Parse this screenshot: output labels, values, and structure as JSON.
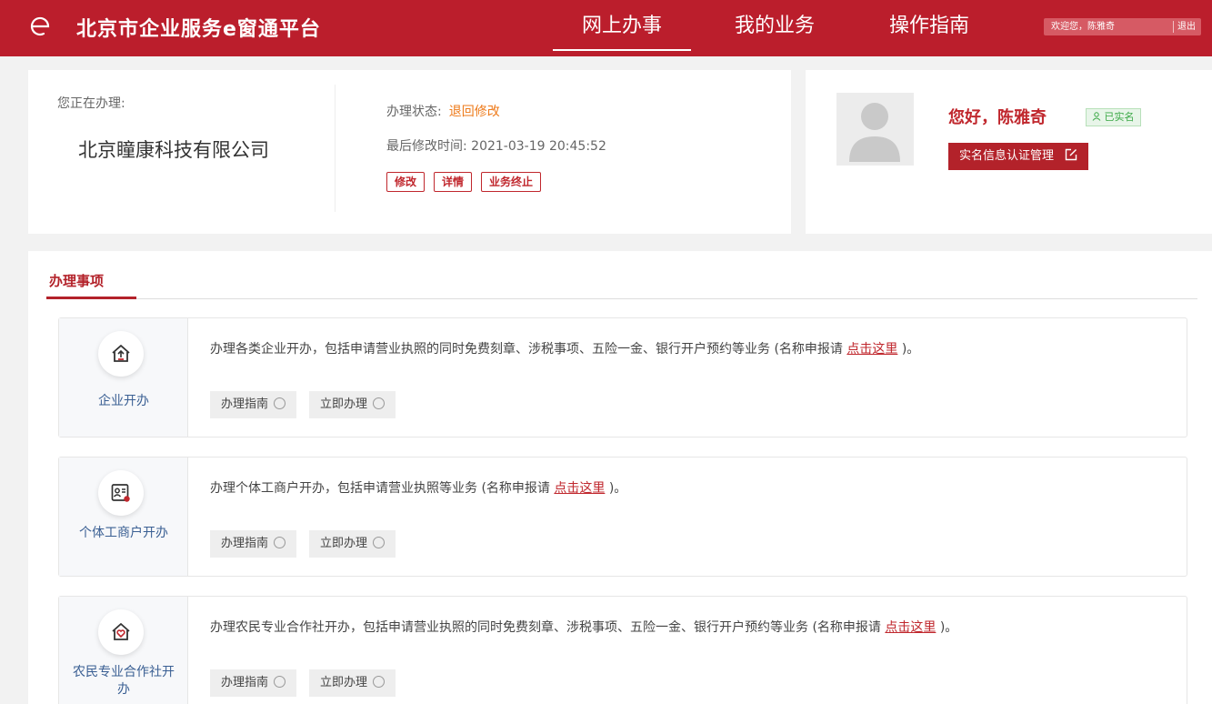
{
  "header": {
    "title": "北京市企业服务e窗通平台",
    "nav": [
      {
        "label": "网上办事"
      },
      {
        "label": "我的业务"
      },
      {
        "label": "操作指南"
      }
    ],
    "welcome": "欢迎您，陈雅奇",
    "logout": "退出",
    "logo_icon": "e-logo-icon"
  },
  "business": {
    "handling_label": "您正在办理:",
    "company": "北京瞳康科技有限公司",
    "status_label": "办理状态:",
    "status_value": "退回修改",
    "time_label": "最后修改时间:",
    "time_value": "2021-03-19 20:45:52",
    "actions": [
      "修改",
      "详情",
      "业务终止"
    ],
    "status_color": "#ee7a1a"
  },
  "user": {
    "greeting": "您好，陈雅奇",
    "verified": "已实名",
    "auth_button": "实名信息认证管理"
  },
  "section": {
    "tab": "办理事项"
  },
  "services": [
    {
      "label": "企业开办",
      "desc": "办理各类企业开办，包括申请营业执照的同时免费刻章、涉税事项、五险一金、银行开户预约等业务 (名称申报请",
      "link": "点击这里",
      "desc_end": ")。",
      "guide": "办理指南",
      "apply": "立即办理",
      "icon": "house-upload-icon"
    },
    {
      "label": "个体工商户开办",
      "desc": "办理个体工商户开办，包括申请营业执照等业务 (名称申报请",
      "link": "点击这里",
      "desc_end": ")。",
      "guide": "办理指南",
      "apply": "立即办理",
      "icon": "id-card-icon"
    },
    {
      "label": "农民专业合作社开办",
      "desc": "办理农民专业合作社开办，包括申请营业执照的同时免费刻章、涉税事项、五险一金、银行开户预约等业务 (名称申报请",
      "link": "点击这里",
      "desc_end": ")。",
      "guide": "办理指南",
      "apply": "立即办理",
      "icon": "house-heart-icon"
    }
  ],
  "colors": {
    "brand": "#bb1e2c",
    "link": "#c0272d",
    "label_blue": "#3a5f93"
  }
}
